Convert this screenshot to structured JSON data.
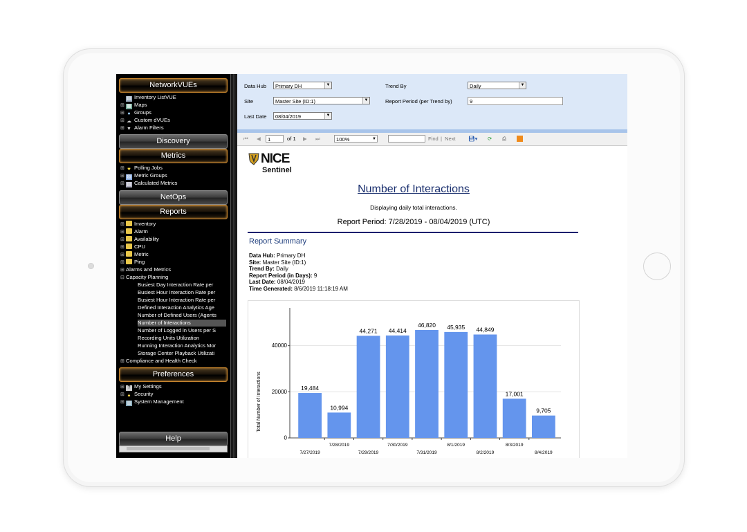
{
  "sidebar": {
    "sections": {
      "networkvues": "NetworkVUEs",
      "discovery": "Discovery",
      "metrics": "Metrics",
      "netops": "NetOps",
      "reports": "Reports",
      "preferences": "Preferences",
      "help": "Help"
    },
    "networkvues_items": [
      "Inventory ListVUE",
      "Maps",
      "Groups",
      "Custom dVUEs",
      "Alarm Filters"
    ],
    "metrics_items": [
      "Polling Jobs",
      "Metric Groups",
      "Calculated Metrics"
    ],
    "reports_items": [
      "Inventory",
      "Alarm",
      "Availability",
      "CPU",
      "Metric",
      "Ping",
      "Alarms and Metrics",
      "Capacity Planning"
    ],
    "capacity_items": [
      "Busiest Day Interaction Rate per",
      "Busiest Hour Interaction Rate per",
      "Busiest Hour Interaction Rate per",
      "Defined Interaction Analytics Age",
      "Number of Defined Users (Agents",
      "Number of Interactions",
      "Number of Logged in Users per S",
      "Recording Units Utilization",
      "Running Interaction Analytics Mor",
      "Storage Center Playback Utilizati"
    ],
    "compliance": "Compliance and Health Check",
    "preferences_items": [
      "My Settings",
      "Security",
      "System Management"
    ]
  },
  "params": {
    "data_hub_label": "Data Hub",
    "data_hub_value": "Primary DH",
    "site_label": "Site",
    "site_value": "Master Site (ID:1)",
    "last_date_label": "Last Date",
    "last_date_value": "08/04/2019",
    "trend_by_label": "Trend By",
    "trend_by_value": "Daily",
    "report_period_label": "Report Period (per Trend by)",
    "report_period_value": "9"
  },
  "toolbar": {
    "page_value": "1",
    "page_of": "of 1",
    "zoom": "100%",
    "find": "Find",
    "next": "Next",
    "separator": "|"
  },
  "report": {
    "logo_nice": "NICE",
    "logo_sentinel": "Sentinel",
    "title": "Number of Interactions",
    "subtitle": "Displaying daily total interactions.",
    "period": "Report Period: 7/28/2019 - 08/04/2019 (UTC)",
    "summary_heading": "Report Summary",
    "summary": [
      {
        "k": "Data Hub:",
        "v": "Primary DH"
      },
      {
        "k": "Site:",
        "v": "Master Site (ID:1)"
      },
      {
        "k": "Trend By:",
        "v": "Daily"
      },
      {
        "k": "Report Period (in Days):",
        "v": "9"
      },
      {
        "k": "Last Date:",
        "v": "08/04/2019"
      },
      {
        "k": "Time Generated:",
        "v": "8/6/2019 11:18:19 AM"
      }
    ]
  },
  "chart_data": {
    "type": "bar",
    "categories": [
      "7/27/2019",
      "7/28/2019",
      "7/29/2019",
      "7/30/2019",
      "7/31/2019",
      "8/1/2019",
      "8/2/2019",
      "8/3/2019",
      "8/4/2019"
    ],
    "values": [
      19484,
      10994,
      44271,
      44414,
      46820,
      45935,
      44849,
      17001,
      9705
    ],
    "value_labels": [
      "19,484",
      "10,994",
      "44,271",
      "44,414",
      "46,820",
      "45,935",
      "44,849",
      "17,001",
      "9,705"
    ],
    "ylabel": "Total Number of Interactions",
    "yticks": [
      0,
      20000,
      40000
    ],
    "ylim": [
      0,
      54000
    ],
    "grid": true,
    "bar_color": "#6495ed"
  }
}
